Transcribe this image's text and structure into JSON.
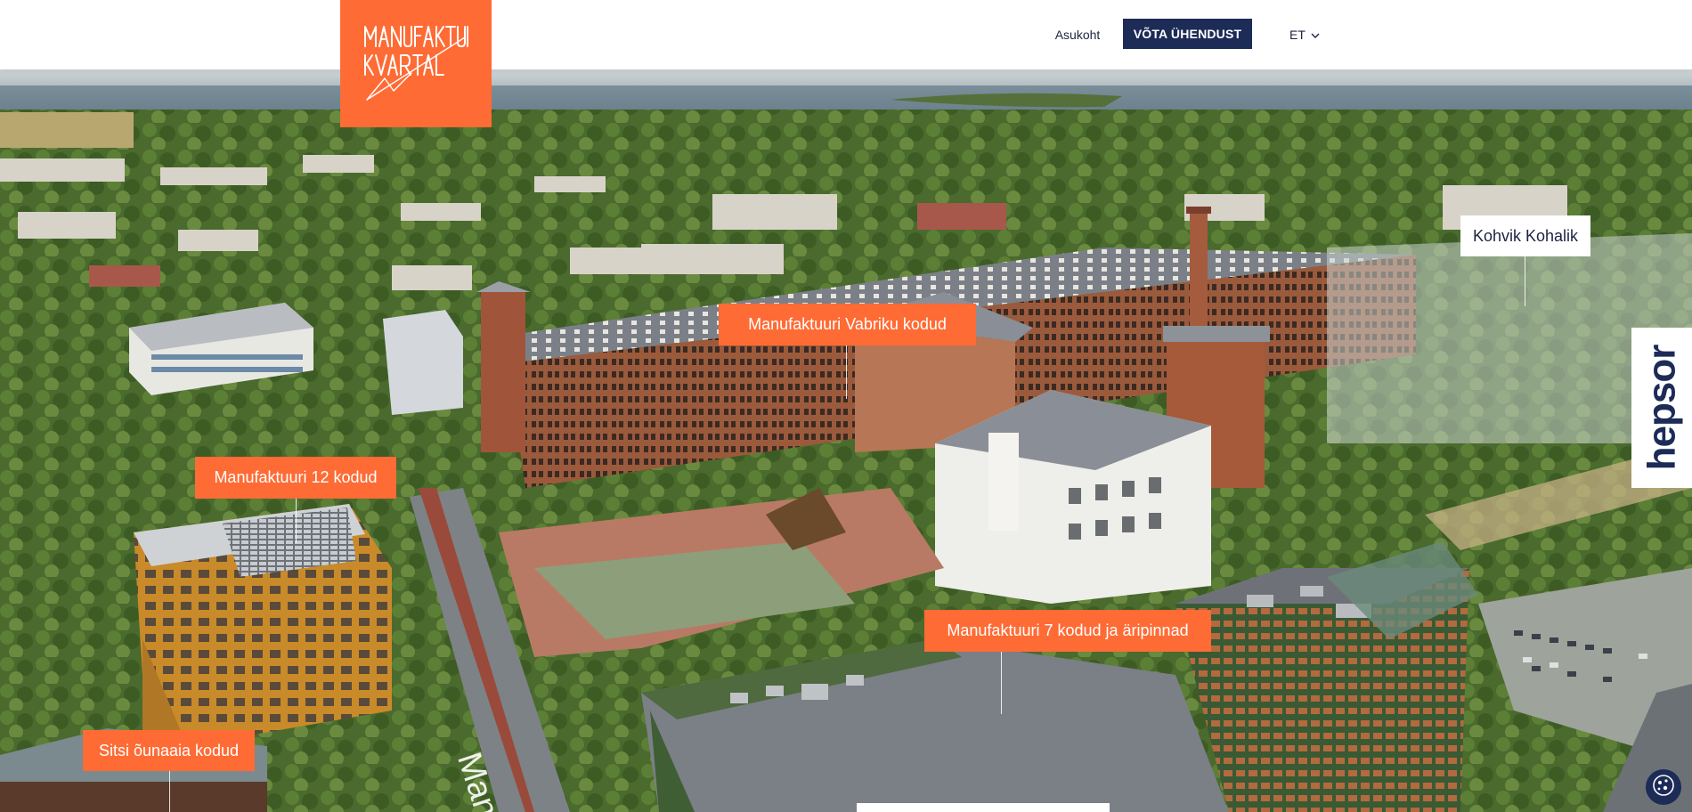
{
  "header": {
    "logo_text": "MANUFAKTUURI KVARTAL",
    "nav_location": "Asukoht",
    "cta": "VÕTA ÜHENDUST",
    "language": "ET"
  },
  "map_labels": [
    "Manufaktuuri Vabriku kodud",
    "Manufaktuuri 12 kodud",
    "Manufaktuuri 7 kodud ja äripinnad",
    "Sitsi õunaaia kodud",
    "Kohvik Kohalik"
  ],
  "street_name": "Manu",
  "partner": {
    "name": "hepsor"
  },
  "colors": {
    "brand_orange": "#ff6b35",
    "navy": "#1d2b57"
  },
  "icons": [
    "chevron-down-icon",
    "cookie-icon"
  ]
}
